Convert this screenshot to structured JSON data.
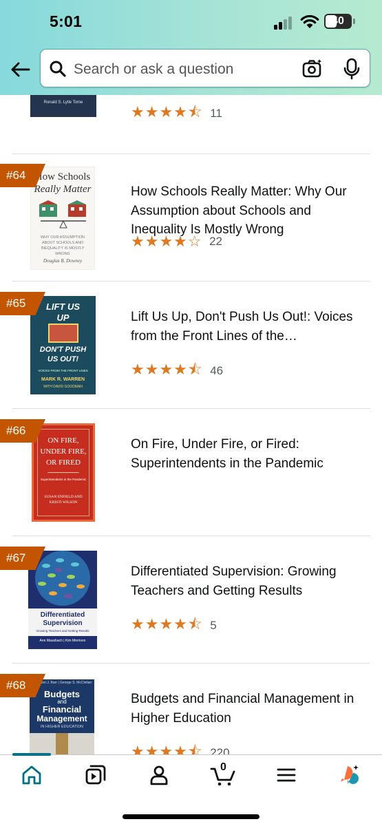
{
  "status": {
    "time": "5:01",
    "battery": "40"
  },
  "search": {
    "placeholder": "Search or ask a question"
  },
  "partial_item": {
    "rating_count": "11"
  },
  "items": [
    {
      "rank": "#64",
      "title": "How Schools Really Matter: Why Our Assumption about Schools and Inequality Is Mostly Wrong",
      "stars": 4.0,
      "stars_display": "★★★★☆",
      "rating_count": "22",
      "cover": {
        "line1": "How Schools",
        "line2": "Really Matter",
        "sub": "WHY OUR ASSUMPTION ABOUT SCHOOLS AND INEQUALITY IS MOSTLY WRONG",
        "author": "Douglas B. Downey"
      }
    },
    {
      "rank": "#65",
      "title": "Lift Us Up, Don't Push Us Out!: Voices from the Front Lines of the…",
      "stars": 4.5,
      "stars_display": "★★★★⯪",
      "rating_count": "46",
      "cover": {
        "line1": "LIFT US",
        "line2": "UP",
        "line3": "DON'T PUSH",
        "line4": "US OUT!",
        "author": "MARK R. WARREN"
      }
    },
    {
      "rank": "#66",
      "title": "On Fire, Under Fire, or Fired: Superintendents in the Pandemic",
      "cover": {
        "line1": "ON FIRE,",
        "line2": "UNDER FIRE,",
        "line3": "OR FIRED",
        "sub": "Superintendents in the Pandemic",
        "author": "SUSAN ENFIELD AND KRISTI WILSON"
      }
    },
    {
      "rank": "#67",
      "title": "Differentiated Supervision: Growing Teachers and Getting Results",
      "stars": 4.5,
      "stars_display": "★★★★⯪",
      "rating_count": "5",
      "cover": {
        "line1": "Differentiated",
        "line2": "Supervision",
        "sub": "Growing Teachers and Getting Results",
        "author": "Ann Mausbach | Kim Morrison"
      }
    },
    {
      "rank": "#68",
      "title": "Budgets and Financial Management in Higher Education",
      "stars": 4.5,
      "stars_display": "★★★★⯪",
      "rating_count": "220",
      "cover": {
        "line1": "Budgets",
        "line2": "and",
        "line3": "Financial",
        "line4": "Management",
        "sub": "IN HIGHER EDUCATION",
        "author": "Margaret J. Barr | George S. McClellan"
      }
    }
  ],
  "nav": {
    "cart_count": "0"
  },
  "colors": {
    "accent": "#007185",
    "badge": "#c45500",
    "star": "#de7921",
    "header": "#a6e3d6"
  }
}
